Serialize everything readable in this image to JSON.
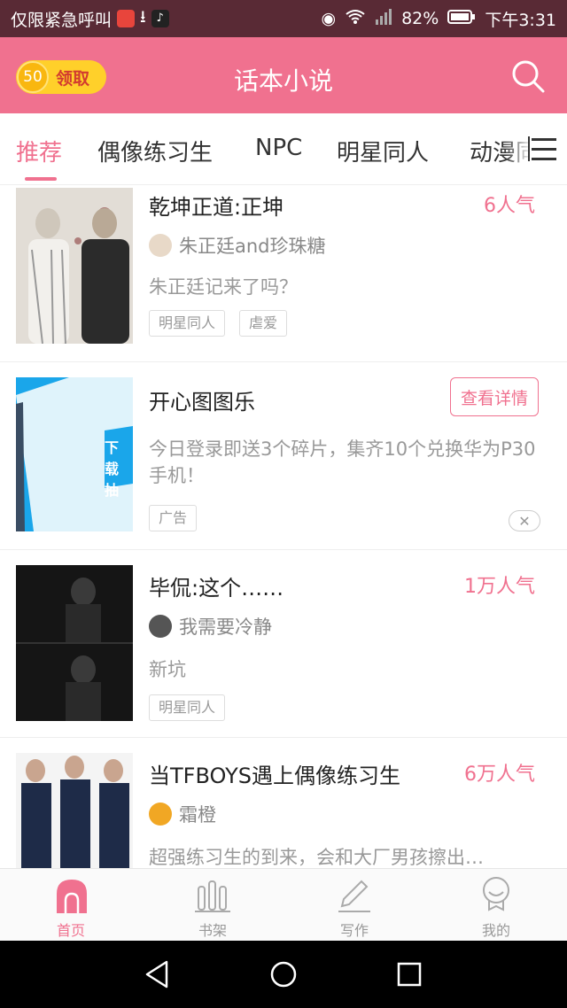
{
  "status_bar": {
    "left_text": "仅限紧急呼叫",
    "battery": "82%",
    "time": "下午3:31"
  },
  "app_bar": {
    "coin_value": "50",
    "coin_label": "领取",
    "title": "话本小说",
    "search_icon": "search-icon"
  },
  "tabs": [
    {
      "label": "推荐",
      "active": true
    },
    {
      "label": "偶像练习生"
    },
    {
      "label": "NPC"
    },
    {
      "label": "明星同人"
    },
    {
      "label": "动漫同人"
    }
  ],
  "stories": [
    {
      "title": "乾坤正道:正坤",
      "popularity": "6人气",
      "author": "朱正廷and珍珠糖",
      "description": "朱正廷记来了吗？",
      "tags": [
        "明星同人",
        "虐爱"
      ]
    },
    {
      "title": "开心图图乐",
      "button_label": "查看详情",
      "description": "今日登录即送3个碎片，集齐10个兑换华为P30手机！",
      "tags": [
        "广告"
      ],
      "cover_text": "下载 抽"
    },
    {
      "title": "毕侃:这个……",
      "popularity": "1万人气",
      "author": "我需要冷静",
      "description": "新坑",
      "tags": [
        "明星同人"
      ]
    },
    {
      "title": "当TFBOYS遇上偶像练习生",
      "popularity": "6万人气",
      "author": "霜橙",
      "description": "超强练习生的到来，会和大厂男孩擦出…"
    }
  ],
  "bottom_nav": [
    {
      "label": "首页",
      "icon": "home-icon",
      "active": true
    },
    {
      "label": "书架",
      "icon": "bookshelf-icon"
    },
    {
      "label": "写作",
      "icon": "pen-icon"
    },
    {
      "label": "我的",
      "icon": "profile-icon"
    }
  ],
  "colors": {
    "accent": "#f0718f",
    "status_bar": "#592a35",
    "coin": "#ffd02a"
  }
}
